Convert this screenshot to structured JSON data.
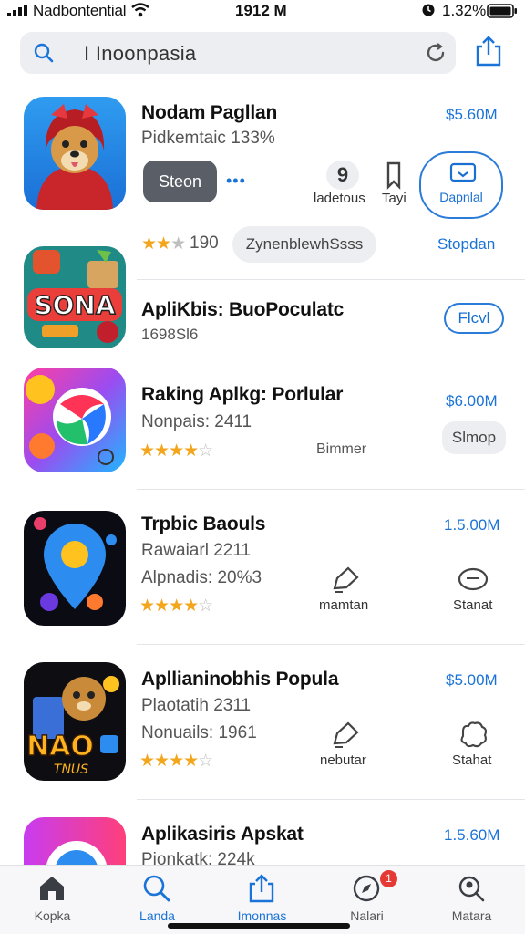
{
  "status": {
    "carrier": "Nadbontential",
    "time": "1912 M",
    "battery": "1.32%"
  },
  "search": {
    "query": "I Inoonpasia",
    "icons": {
      "search": "magnifier-icon",
      "reload": "reload-icon",
      "share": "share-icon"
    }
  },
  "apps": [
    {
      "title": "Nodam Pagllan",
      "sub1": "Pidkemtaic 133%",
      "price": "$5.60M",
      "get_label": "Steon",
      "more_label": "•••",
      "action1_label": "ladetous",
      "action2_label": "Tayi",
      "download_label": "Dapnlal",
      "rating_text": "190",
      "rating": 3,
      "chip_label": "ZynenblewhSsss",
      "side_link": "Stopdan",
      "icon": "dog-hoodie-app-icon"
    },
    {
      "title": "ApliKbis: BuoPoculatc",
      "sub1": "1698Sl6",
      "button": "Flcvl",
      "icon": "sonna-game-app-icon"
    },
    {
      "title": "Raking Aplkg: Porlular",
      "sub1": "Nonpais: 2411",
      "price": "$6.00M",
      "rating": 4.5,
      "mid_label": "Bimmer",
      "button": "Slmop",
      "icon": "colorful-swirl-app-icon"
    },
    {
      "title": "Trpbic Baouls",
      "sub1": "Rawaiarl 2211",
      "sub2": "Alpnadis: 20%3",
      "price": "1.5.00M",
      "rating": 3.5,
      "action1_label": "mamtan",
      "action2_label": "Stanat",
      "icon": "map-pin-app-icon"
    },
    {
      "title": "Apllianinobhis Popula",
      "sub1": "Plaotatih 2311",
      "sub2": "Nonuails: 1961",
      "price": "$5.00M",
      "rating": 3.5,
      "action1_label": "nebutar",
      "action2_label": "Stahat",
      "icon": "nao-game-app-icon"
    },
    {
      "title": "Aplikasiris Apskat",
      "sub1": "Pionkatk: 224k",
      "price": "1.5.60M",
      "icon": "blue-circle-app-icon"
    }
  ],
  "tabs": [
    {
      "label": "Kopka",
      "icon": "home-icon"
    },
    {
      "label": "Landa",
      "icon": "search-icon"
    },
    {
      "label": "Imonnas",
      "icon": "share-icon"
    },
    {
      "label": "Nalari",
      "icon": "compass-icon",
      "badge": "1"
    },
    {
      "label": "Matara",
      "icon": "search-person-icon"
    }
  ],
  "colors": {
    "accent": "#1a73d8",
    "star": "#f3a51b",
    "badge": "#e53935"
  }
}
